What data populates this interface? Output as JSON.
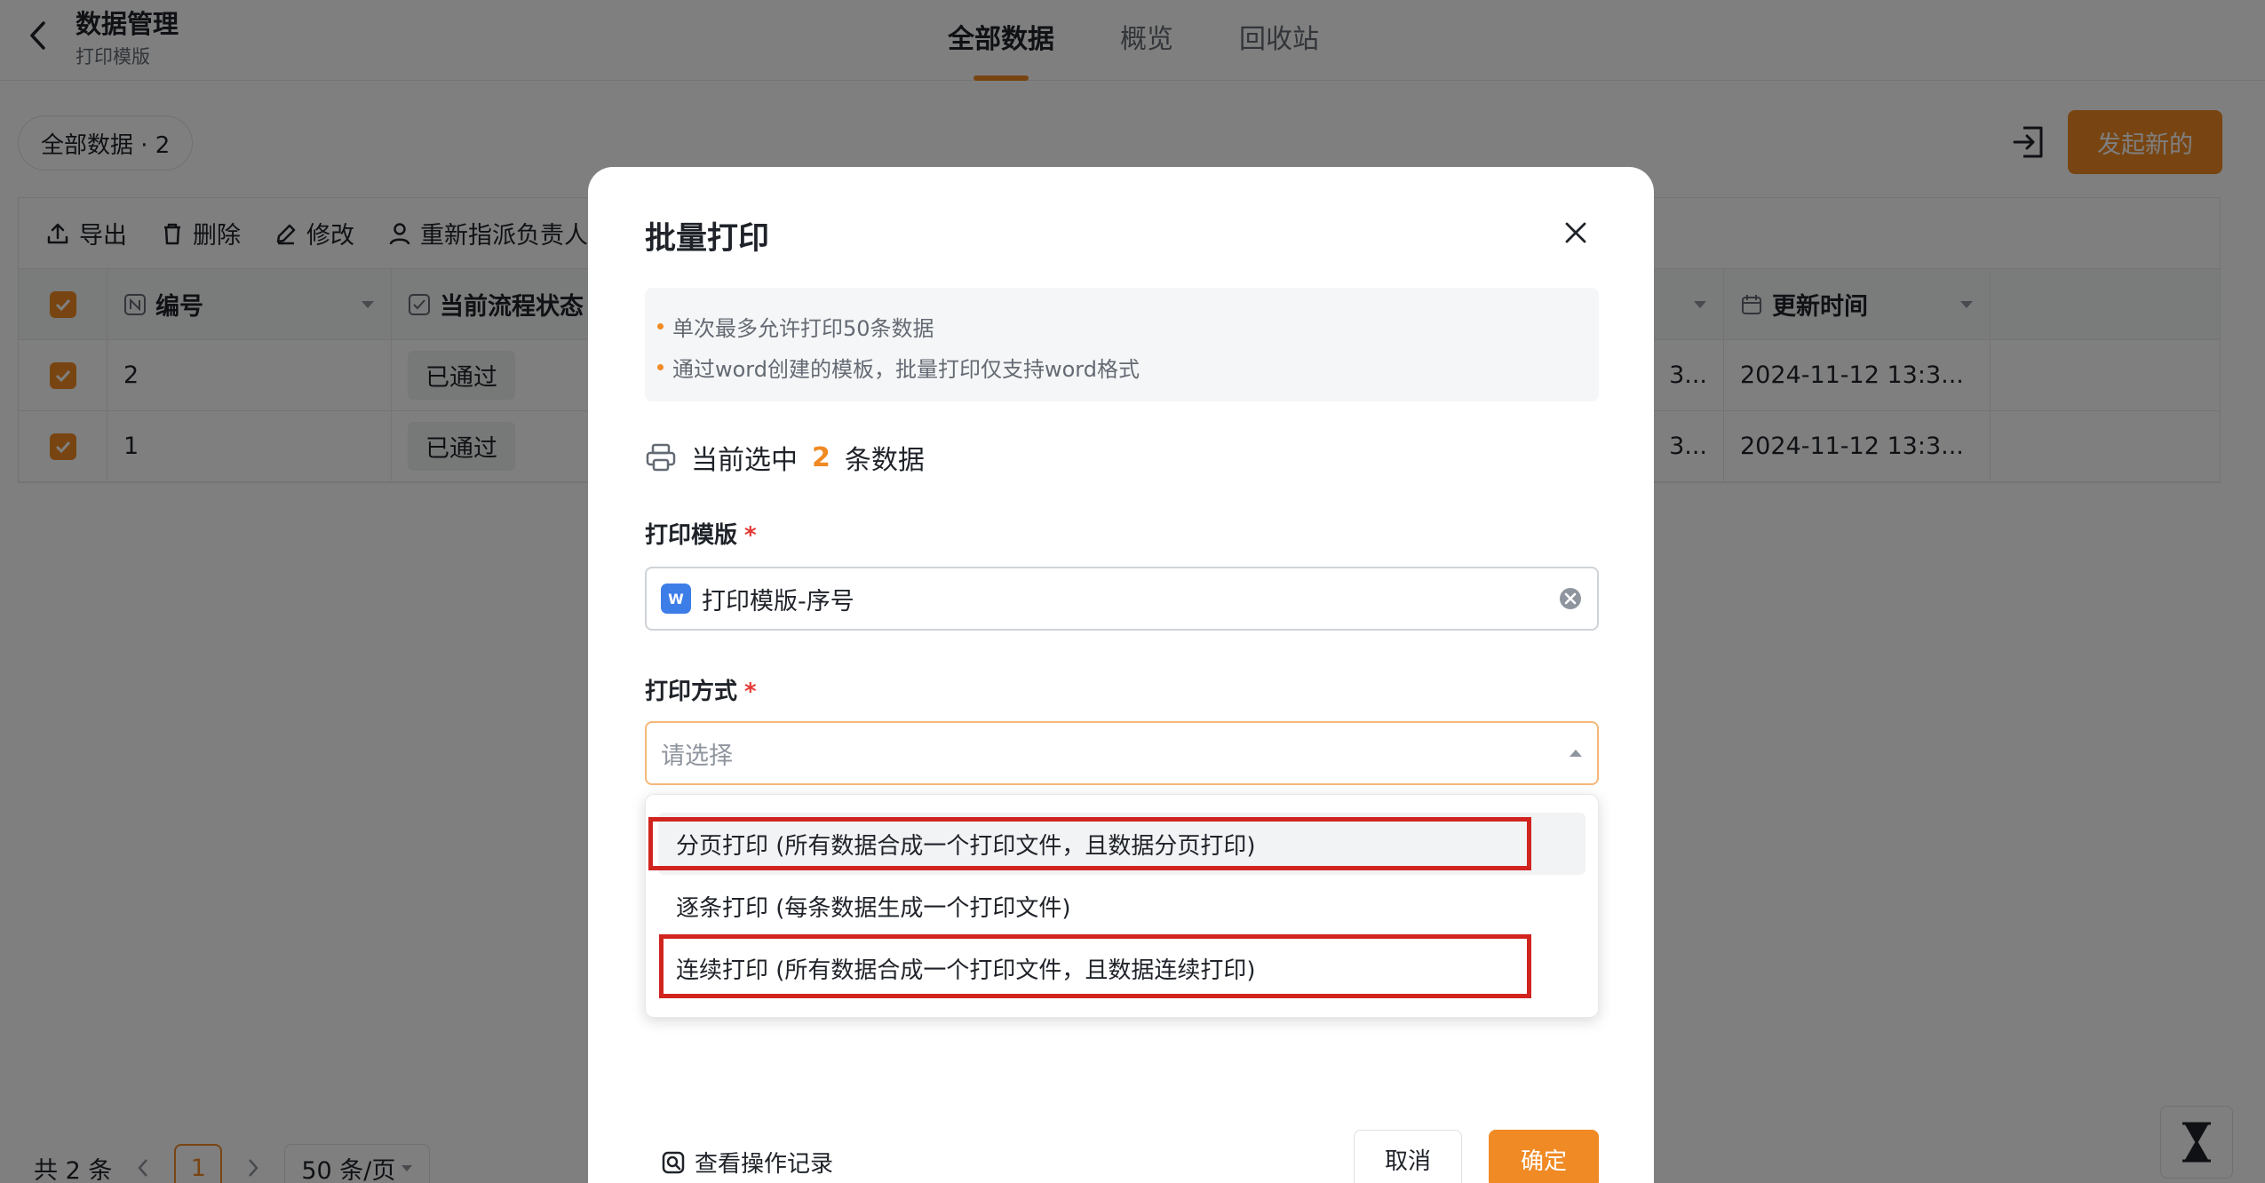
{
  "header": {
    "title": "数据管理",
    "subtitle": "打印模版",
    "tabs": [
      {
        "label": "全部数据"
      },
      {
        "label": "概览"
      },
      {
        "label": "回收站"
      }
    ]
  },
  "toolbar": {
    "view_chip": "全部数据 · 2",
    "start_button": "发起新的"
  },
  "actions": {
    "export": "导出",
    "delete": "删除",
    "edit": "修改",
    "reassign": "重新指派负责人"
  },
  "table": {
    "columns": {
      "number": "编号",
      "status": "当前流程状态",
      "updated": "更新时间"
    },
    "rows": [
      {
        "number": "2",
        "status": "已通过",
        "truncated": "3...",
        "updated": "2024-11-12 13:3..."
      },
      {
        "number": "1",
        "status": "已通过",
        "truncated": "3...",
        "updated": "2024-11-12 13:3..."
      }
    ]
  },
  "pager": {
    "total": "共 2 条",
    "page": "1",
    "size": "50 条/页"
  },
  "modal": {
    "title": "批量打印",
    "notices": [
      "单次最多允许打印50条数据",
      "通过word创建的模板，批量打印仅支持word格式"
    ],
    "selected_prefix": "当前选中",
    "selected_count": "2",
    "selected_suffix": "条数据",
    "template_label": "打印模版",
    "template_value": "打印模版-序号",
    "method_label": "打印方式",
    "method_placeholder": "请选择",
    "options": [
      "分页打印 (所有数据合成一个打印文件，且数据分页打印)",
      "逐条打印 (每条数据生成一个打印文件)",
      "连续打印 (所有数据合成一个打印文件，且数据连续打印)"
    ],
    "log_link": "查看操作记录",
    "cancel": "取消",
    "confirm": "确定"
  },
  "colors": {
    "accent": "#f08a24",
    "highlight": "#d1241f"
  }
}
